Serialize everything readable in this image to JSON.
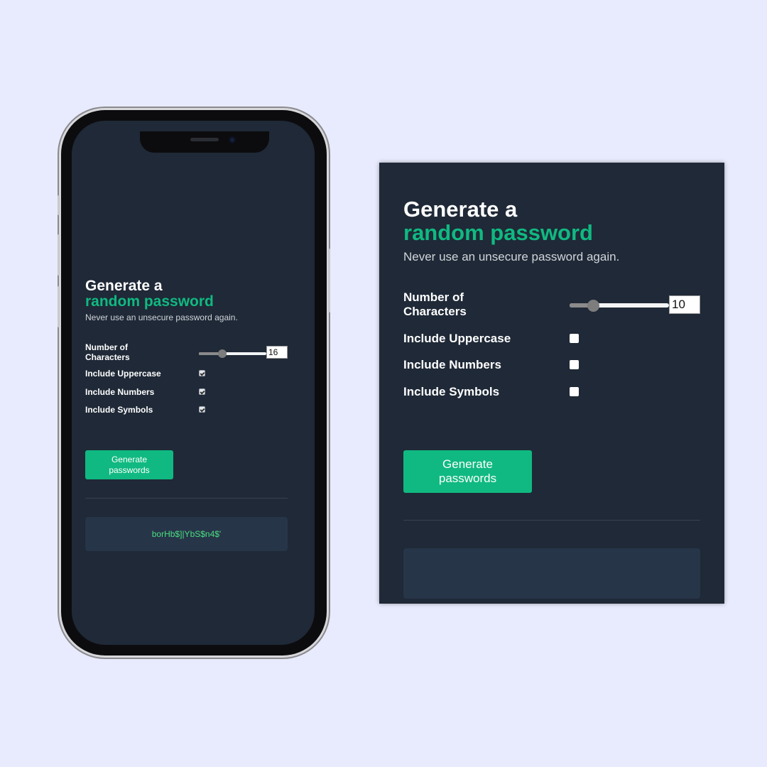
{
  "app": {
    "title_line1": "Generate a",
    "title_line2": "random password",
    "subtitle": "Never use an unsecure password again.",
    "length_label": "Number of Characters",
    "uppercase_label": "Include Uppercase",
    "numbers_label": "Include Numbers",
    "symbols_label": "Include Symbols",
    "generate_label": "Generate passwords"
  },
  "mobile": {
    "length_value": "16",
    "slider_fraction": 0.33,
    "uppercase_checked": true,
    "numbers_checked": true,
    "symbols_checked": true,
    "output": "borHb$]|YbS$n4$'"
  },
  "desktop": {
    "length_value": "10",
    "slider_fraction": 0.2,
    "uppercase_checked": false,
    "numbers_checked": false,
    "symbols_checked": false,
    "output": ""
  },
  "colors": {
    "background": "#e8ebfd",
    "panel": "#1f2937",
    "accent": "#10b981",
    "output_bg": "#273549",
    "output_text": "#4ade80"
  }
}
